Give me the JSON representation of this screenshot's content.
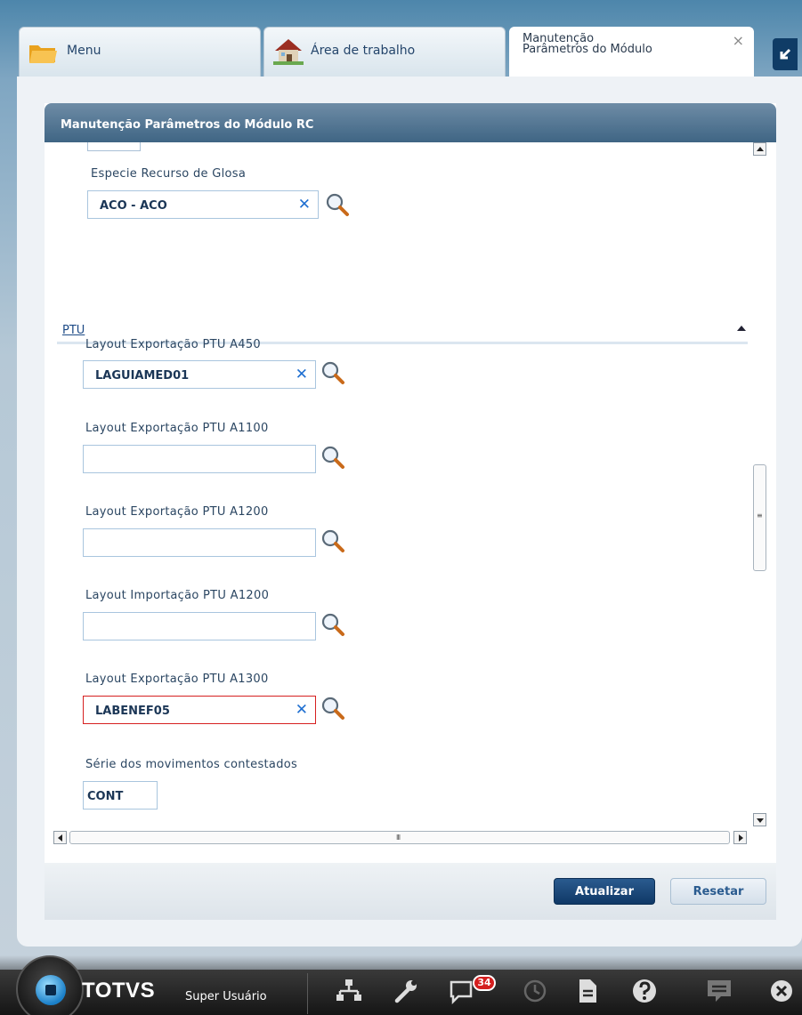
{
  "tabs": [
    {
      "label": "Menu",
      "icon": "folder-icon"
    },
    {
      "label": "Área de trabalho",
      "icon": "house-icon"
    },
    {
      "label": "Manutenção\nParâmetros do Módulo",
      "close": "×"
    }
  ],
  "panel": {
    "title": "Manutenção Parâmetros do Módulo RC"
  },
  "fields": {
    "especie_recurso_glosa": {
      "label": "Especie Recurso de Glosa",
      "value": "ACO - ACO",
      "clear": "✕"
    },
    "section_ptu": {
      "title": "PTU"
    },
    "ptu_a450": {
      "label": "Layout Exportação PTU A450",
      "value": "LAGUIAMED01",
      "clear": "✕"
    },
    "ptu_a1100": {
      "label": "Layout Exportação PTU A1100",
      "value": ""
    },
    "ptu_a1200_exp": {
      "label": "Layout Exportação PTU A1200",
      "value": ""
    },
    "ptu_a1200_imp": {
      "label": "Layout Importação PTU A1200",
      "value": ""
    },
    "ptu_a1300": {
      "label": "Layout Exportação PTU A1300",
      "value": "LABENEF05",
      "clear": "✕"
    },
    "serie_movimentos": {
      "label": "Série dos movimentos contestados",
      "value": "CONT"
    }
  },
  "buttons": {
    "update": "Atualizar",
    "reset": "Resetar"
  },
  "taskbar": {
    "brand": "TOTVS",
    "user": "Super Usuário",
    "notifications": "34"
  },
  "colors": {
    "header": "#3f6584",
    "primary_button": "#0f3866",
    "error_border": "#d62020",
    "clear_icon": "#1f6fd1"
  }
}
